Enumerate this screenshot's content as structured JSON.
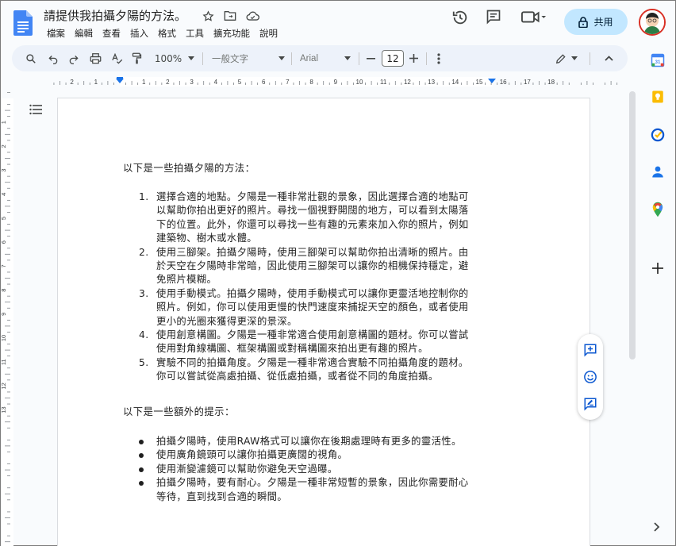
{
  "header": {
    "title": "請提供我拍攝夕陽的方法。",
    "menu": [
      "檔案",
      "編輯",
      "查看",
      "插入",
      "格式",
      "工具",
      "擴充功能",
      "說明"
    ],
    "share_label": "共用"
  },
  "toolbar": {
    "zoom": "100%",
    "style": "一般文字",
    "font": "Arial",
    "font_size": "12"
  },
  "ruler": {
    "ticks": [
      "2",
      "1",
      "1",
      "2",
      "3",
      "4",
      "5",
      "6",
      "7",
      "8",
      "9",
      "10",
      "11",
      "12",
      "13",
      "14",
      "15",
      "16",
      "17",
      "18"
    ],
    "left_ticks": [
      "1",
      "1",
      "2",
      "3",
      "4",
      "5",
      "6",
      "7",
      "8",
      "9",
      "10",
      "11",
      "12",
      "13"
    ]
  },
  "document": {
    "intro": "以下是一些拍攝夕陽的方法：",
    "steps": [
      {
        "num": "1.",
        "lines": [
          "選擇合適的地點。夕陽是一種非常壯觀的景象，因此選擇合適的地點可",
          "以幫助你拍出更好的照片。尋找一個視野開闊的地方，可以看到太陽落",
          "下的位置。此外，你還可以尋找一些有趣的元素來加入你的照片，例如",
          "建築物、樹木或水體。"
        ]
      },
      {
        "num": "2.",
        "lines": [
          "使用三腳架。拍攝夕陽時，使用三腳架可以幫助你拍出清晰的照片。由",
          "於天空在夕陽時非常暗，因此使用三腳架可以讓你的相機保持穩定，避",
          "免照片模糊。"
        ]
      },
      {
        "num": "3.",
        "lines": [
          "使用手動模式。拍攝夕陽時，使用手動模式可以讓你更靈活地控制你的",
          "照片。例如，你可以使用更慢的快門速度來捕捉天空的顏色，或者使用",
          "更小的光圈來獲得更深的景深。"
        ]
      },
      {
        "num": "4.",
        "lines": [
          "使用創意構圖。夕陽是一種非常適合使用創意構圖的題材。你可以嘗試",
          "使用對角線構圖、框架構圖或對稱構圖來拍出更有趣的照片。"
        ]
      },
      {
        "num": "5.",
        "lines": [
          "實驗不同的拍攝角度。夕陽是一種非常適合實驗不同拍攝角度的題材。",
          "你可以嘗試從高處拍攝、從低處拍攝，或者從不同的角度拍攝。"
        ]
      }
    ],
    "extra_title": "以下是一些額外的提示：",
    "tips": [
      {
        "lines": [
          "拍攝夕陽時，使用RAW格式可以讓你在後期處理時有更多的靈活性。"
        ]
      },
      {
        "lines": [
          "使用廣角鏡頭可以讓你拍攝更廣闊的視角。"
        ]
      },
      {
        "lines": [
          "使用漸變濾鏡可以幫助你避免天空過曝。"
        ]
      },
      {
        "lines": [
          "拍攝夕陽時，要有耐心。夕陽是一種非常短暫的景象，因此你需要耐心",
          "等待，直到找到合適的瞬間。"
        ]
      }
    ]
  },
  "colors": {
    "accent": "#0b57d0",
    "share_bg": "#c2e7ff",
    "toolbar_bg": "#edf2fa",
    "page_bg": "#ffffff",
    "app_bg": "#f9fbfd"
  },
  "icons": {
    "toolbar": [
      "search-icon",
      "undo-icon",
      "redo-icon",
      "print-icon",
      "spellcheck-icon",
      "paint-format-icon"
    ],
    "side": [
      "calendar-icon",
      "keep-icon",
      "tasks-icon",
      "contacts-icon",
      "maps-icon",
      "add-icon"
    ],
    "float": [
      "add-comment-icon",
      "emoji-icon",
      "suggest-edit-icon"
    ]
  }
}
